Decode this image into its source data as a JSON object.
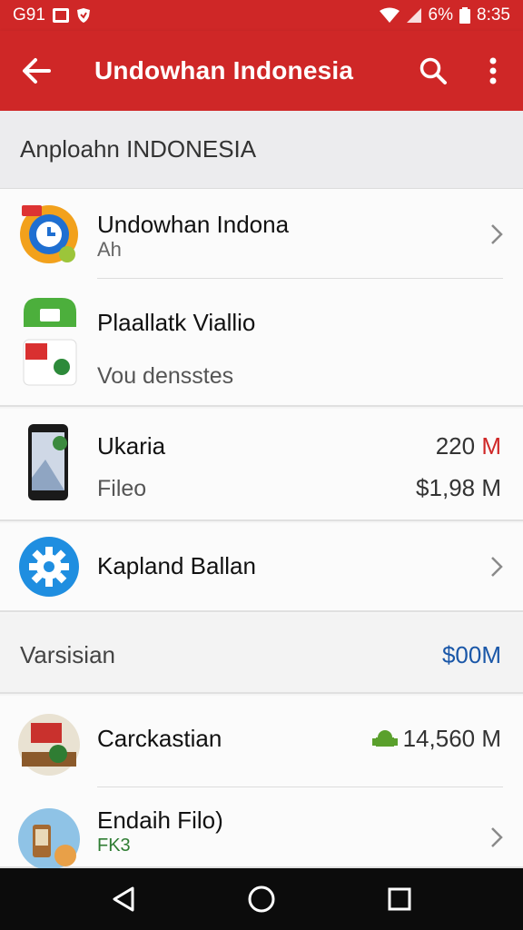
{
  "status_bar": {
    "left_text": "G91",
    "right_text": "6%",
    "time": "8:35"
  },
  "toolbar": {
    "title": "Undowhan Indonesia"
  },
  "section_header": "Anploahn INDONESIA",
  "items": [
    {
      "title": "Undowhan Indona",
      "subtitle": "Ah",
      "icon": "clock-app-icon"
    },
    {
      "title": "Plaallatk Viallio",
      "subtitle": "Vou densstes",
      "icon": "flag-app-icon"
    },
    {
      "title": "Ukaria",
      "subtitle": "Fileo",
      "value_top": "220",
      "value_top_unit": "M",
      "value_bottom": "$1,98 M",
      "icon": "phone-icon"
    },
    {
      "title": "Kapland Ballan",
      "icon": "settings-gear-icon"
    },
    {
      "title": "Varsisian",
      "value": "$00M"
    },
    {
      "title": "Carckastian",
      "value": "14,560 M",
      "icon": "desk-app-icon"
    },
    {
      "title": "Endaih Filo)",
      "subtitle": "FK3",
      "icon": "phone-avatar-icon"
    }
  ],
  "colors": {
    "accent": "#cf2727",
    "link_blue": "#1a57a8",
    "chevron": "#8a8a8a"
  }
}
